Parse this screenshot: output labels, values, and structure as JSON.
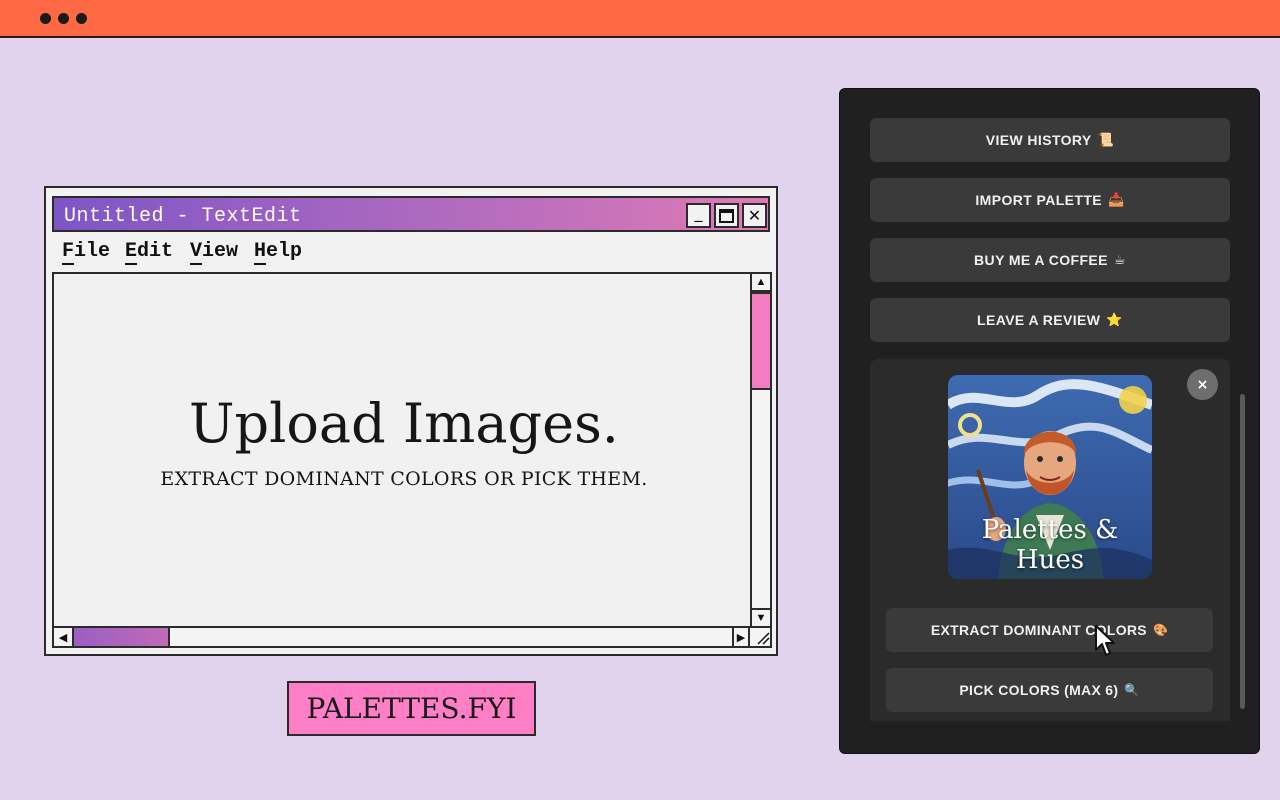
{
  "topbar": {
    "color": "#ff6a45",
    "dots": [
      "dot",
      "dot",
      "dot"
    ]
  },
  "window": {
    "title": "Untitled - TextEdit",
    "controls": {
      "minimize": "_",
      "maximize": "□",
      "close": "✕"
    },
    "menu": [
      {
        "label": "File"
      },
      {
        "label": "Edit"
      },
      {
        "label": "View"
      },
      {
        "label": "Help"
      }
    ],
    "headline": "Upload Images.",
    "subline": "EXTRACT DOMINANT COLORS OR PICK THEM.",
    "scroll_arrows": {
      "up": "▲",
      "down": "▼",
      "left": "◀",
      "right": "▶"
    }
  },
  "brand": {
    "label": "PALETTES.FYI",
    "color": "#ff7fc7"
  },
  "panel": {
    "buttons": [
      {
        "label": "VIEW HISTORY",
        "icon": "📜"
      },
      {
        "label": "IMPORT PALETTE",
        "icon": "📥"
      },
      {
        "label": "BUY ME A COFFEE",
        "icon": "☕"
      },
      {
        "label": "LEAVE A REVIEW",
        "icon": "⭐"
      }
    ],
    "card": {
      "image_caption": "Palettes & Hues",
      "close_label": "×",
      "actions": [
        {
          "label": "EXTRACT DOMINANT COLORS",
          "icon": "🎨"
        },
        {
          "label": "PICK COLORS (MAX 6)",
          "icon": "🔍"
        }
      ]
    }
  }
}
